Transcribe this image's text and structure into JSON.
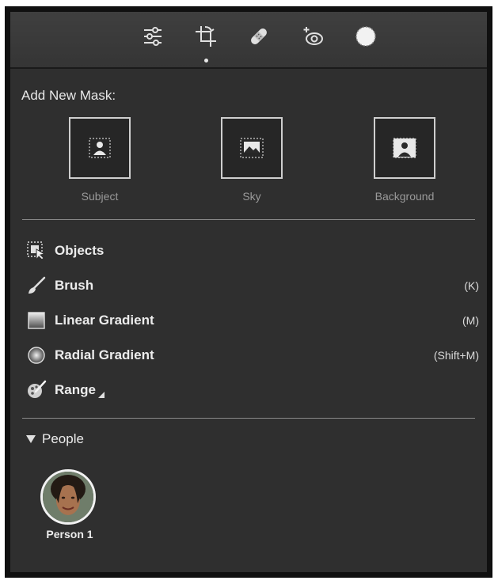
{
  "toolbar": {
    "tools": [
      {
        "icon": "sliders-icon",
        "name": "Edit"
      },
      {
        "icon": "crop-icon",
        "name": "Crop"
      },
      {
        "icon": "bandage-icon",
        "name": "Heal"
      },
      {
        "icon": "red-eye-icon",
        "name": "Red Eye"
      },
      {
        "icon": "mask-icon",
        "name": "Masking"
      }
    ],
    "active_index": 1
  },
  "add_mask": {
    "title": "Add New Mask:",
    "buttons": [
      {
        "label": "Subject",
        "icon": "subject-icon"
      },
      {
        "label": "Sky",
        "icon": "sky-icon"
      },
      {
        "label": "Background",
        "icon": "background-icon"
      }
    ]
  },
  "tools_list": [
    {
      "label": "Objects",
      "icon": "objects-icon",
      "shortcut": ""
    },
    {
      "label": "Brush",
      "icon": "brush-icon",
      "shortcut": "(K)"
    },
    {
      "label": "Linear Gradient",
      "icon": "linear-gradient-icon",
      "shortcut": "(M)"
    },
    {
      "label": "Radial Gradient",
      "icon": "radial-gradient-icon",
      "shortcut": "(Shift+M)"
    },
    {
      "label": "Range",
      "icon": "range-icon",
      "shortcut": ""
    }
  ],
  "people": {
    "title": "People",
    "persons": [
      {
        "label": "Person 1"
      }
    ]
  },
  "colors": {
    "panel_bg": "#2f2f2f",
    "text": "#ececec",
    "muted_text": "#9a9a9a",
    "divider": "#8a8a8a"
  }
}
